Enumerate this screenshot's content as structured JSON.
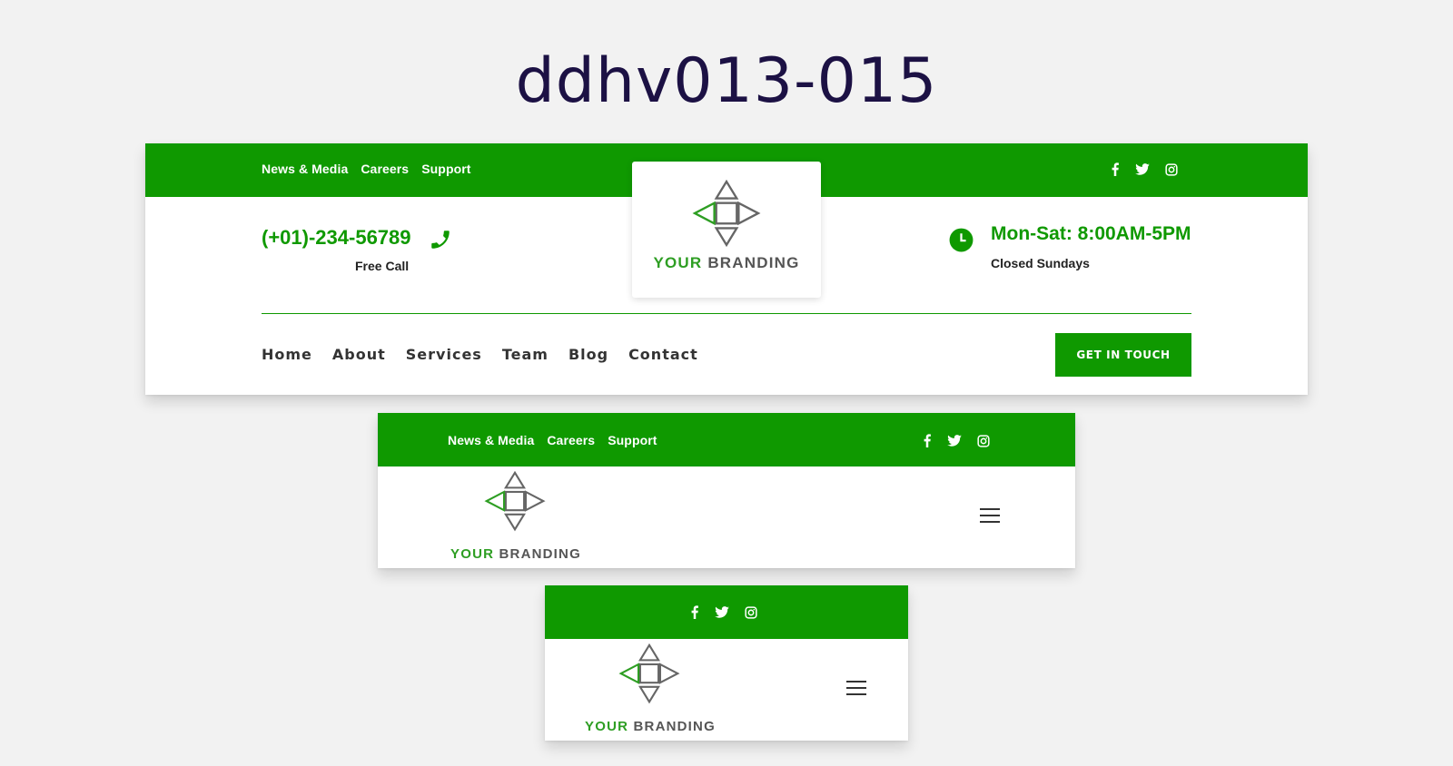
{
  "page": {
    "title": "ddhv013-015"
  },
  "colors": {
    "green": "#0f9900",
    "dark": "#1c1144",
    "text": "#333333"
  },
  "header1": {
    "top_links": [
      "News & Media",
      "Careers",
      "Support"
    ],
    "social_icons": [
      "facebook-icon",
      "twitter-icon",
      "instagram-icon"
    ],
    "phone": "(+01)-234-56789",
    "phone_sub": "Free Call",
    "hours": "Mon-Sat: 8:00AM-5PM",
    "hours_sub": "Closed Sundays",
    "brand_1": "YOUR",
    "brand_2": "BRANDING",
    "nav": [
      "Home",
      "About",
      "Services",
      "Team",
      "Blog",
      "Contact"
    ],
    "cta": "GET IN TOUCH"
  },
  "header2": {
    "top_links": [
      "News & Media",
      "Careers",
      "Support"
    ],
    "brand_1": "YOUR",
    "brand_2": "BRANDING"
  },
  "header3": {
    "brand_1": "YOUR",
    "brand_2": "BRANDING"
  }
}
